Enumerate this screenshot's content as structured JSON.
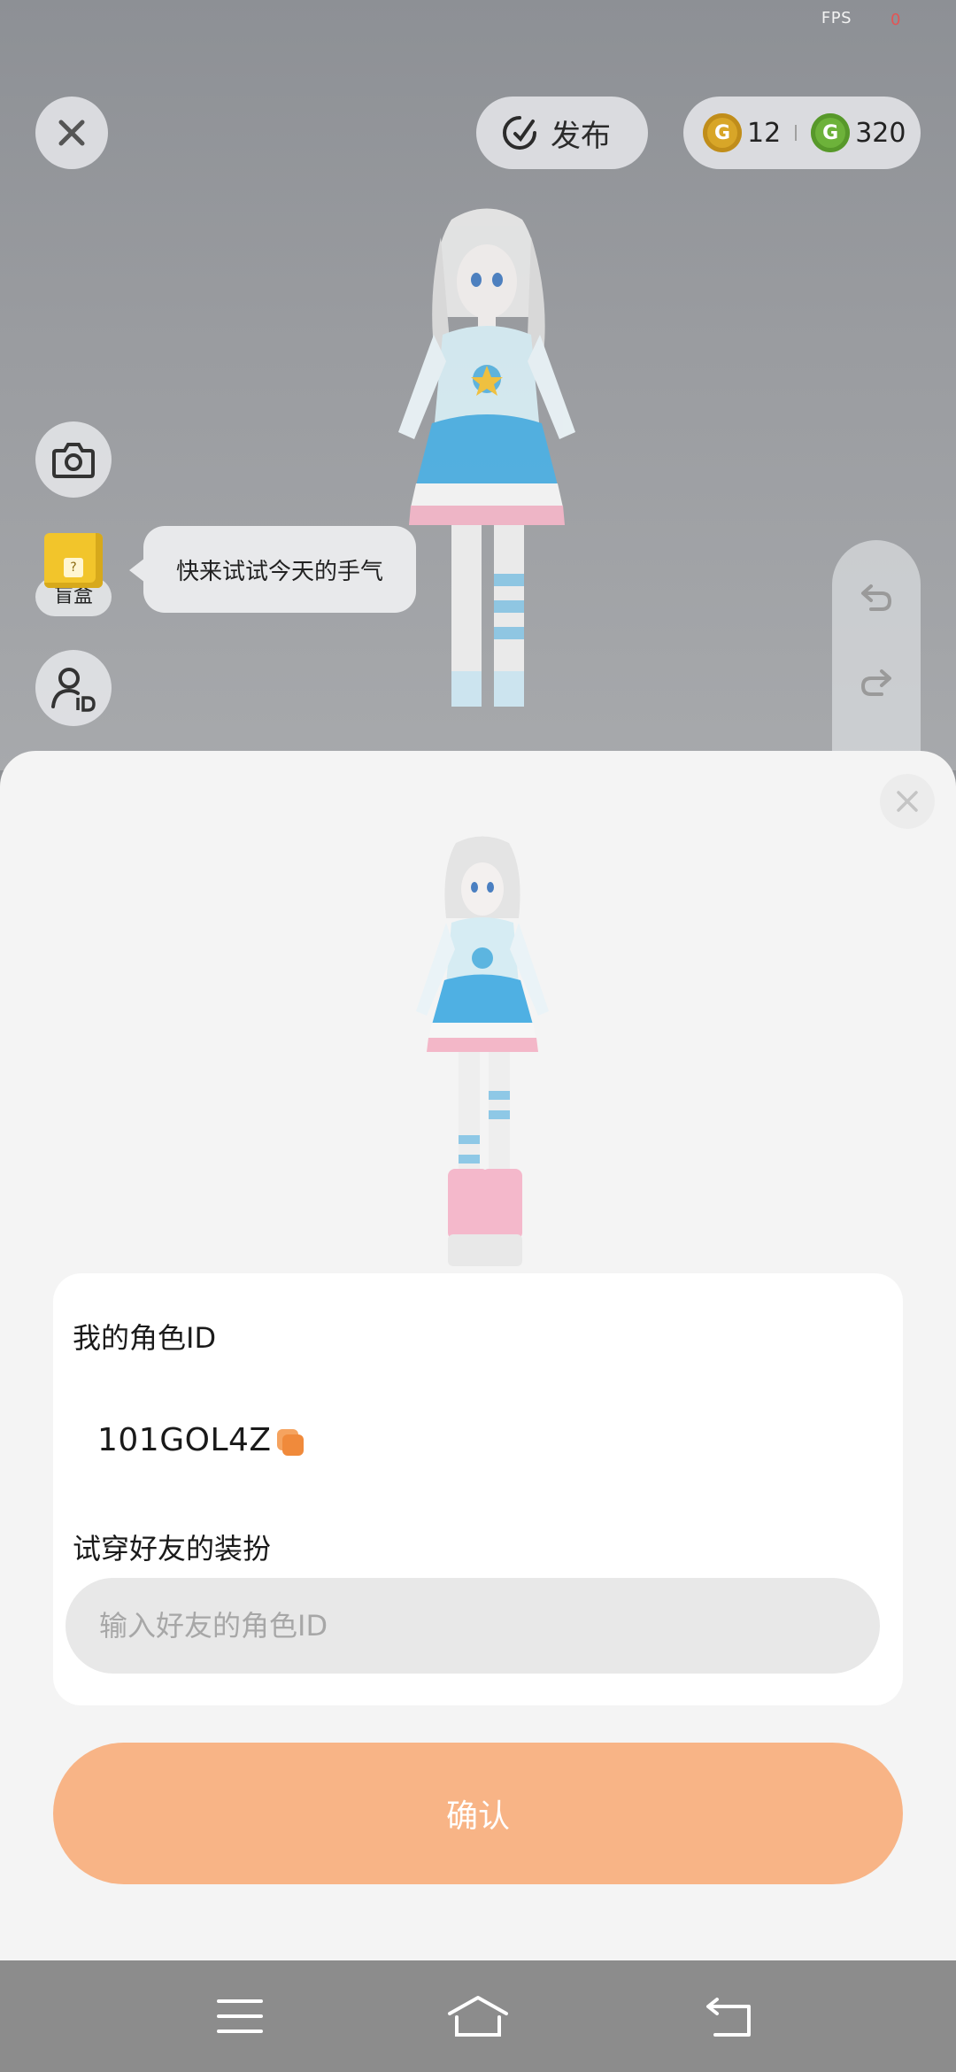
{
  "status": {
    "fps_label": "FPS",
    "fps_value": "0"
  },
  "top_bar": {
    "publish_label": "发布",
    "currency": [
      {
        "icon": "gold-coin-icon",
        "letter": "G",
        "value": "12",
        "color": "#d8a628"
      },
      {
        "icon": "green-coin-icon",
        "letter": "G",
        "value": "320",
        "color": "#6db23a"
      }
    ]
  },
  "side": {
    "blindbox_label": "盲盒",
    "blindbox_glyph": "?",
    "bubble_text": "快来试试今天的手气"
  },
  "sheet": {
    "my_id_label": "我的角色ID",
    "my_id_value": "101GOL4Z",
    "try_label": "试穿好友的装扮",
    "input_placeholder": "输入好友的角色ID",
    "confirm_label": "确认"
  },
  "colors": {
    "accent": "#f8b486",
    "scene_bg": "#9a9ca0",
    "sheet_bg": "#f4f4f4",
    "navbar_bg": "#8c8c8c"
  }
}
